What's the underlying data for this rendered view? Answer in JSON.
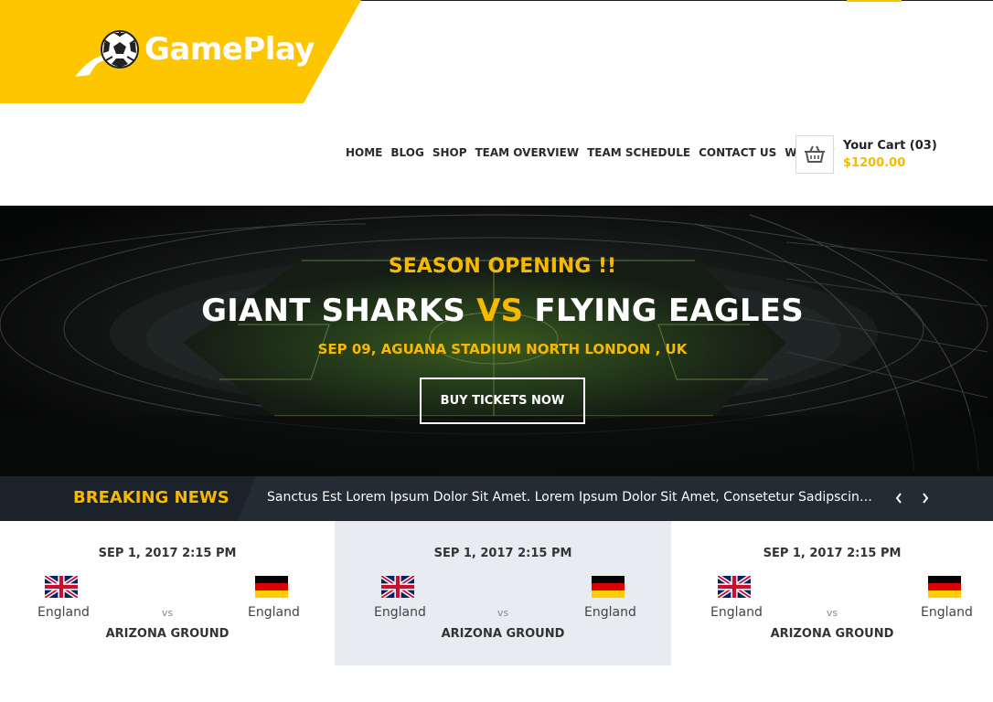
{
  "brand": {
    "name": "GamePlay",
    "accent": "#f7c300"
  },
  "nav": [
    "HOME",
    "BLOG",
    "SHOP",
    "TEAM OVERVIEW",
    "TEAM SCHEDULE",
    "CONTACT US",
    "WIDGET"
  ],
  "cart": {
    "icon": "basket-icon",
    "title": "Your Cart (03)",
    "total": "$1200.00"
  },
  "hero": {
    "kicker": "SEASON OPENING !!",
    "team_home": "GIANT SHARKS",
    "vs": "VS",
    "team_away": "FLYING EAGLES",
    "venue": "SEP 09, AGUANA STADIUM NORTH LONDON , UK",
    "cta": "BUY TICKETS NOW"
  },
  "breaking_news": {
    "label": "BREAKING NEWS",
    "text": "Sanctus Est Lorem Ipsum Dolor Sit Amet. Lorem Ipsum Dolor Sit Amet, Consetetur Sadipscing Elitr, Sed Diam Nonumy",
    "prev_icon": "chevron-left-icon",
    "next_icon": "chevron-right-icon"
  },
  "matches": [
    {
      "date": "SEP 1, 2017 2:15 PM",
      "home": "England",
      "away": "England",
      "vs": "vs",
      "ground": "ARIZONA GROUND",
      "home_flag": "uk-flag-icon",
      "away_flag": "germany-flag-icon"
    },
    {
      "date": "SEP 1, 2017 2:15 PM",
      "home": "England",
      "away": "England",
      "vs": "vs",
      "ground": "ARIZONA GROUND",
      "home_flag": "uk-flag-icon",
      "away_flag": "germany-flag-icon"
    },
    {
      "date": "SEP 1, 2017 2:15 PM",
      "home": "England",
      "away": "England",
      "vs": "vs",
      "ground": "ARIZONA GROUND",
      "home_flag": "uk-flag-icon",
      "away_flag": "germany-flag-icon"
    }
  ]
}
